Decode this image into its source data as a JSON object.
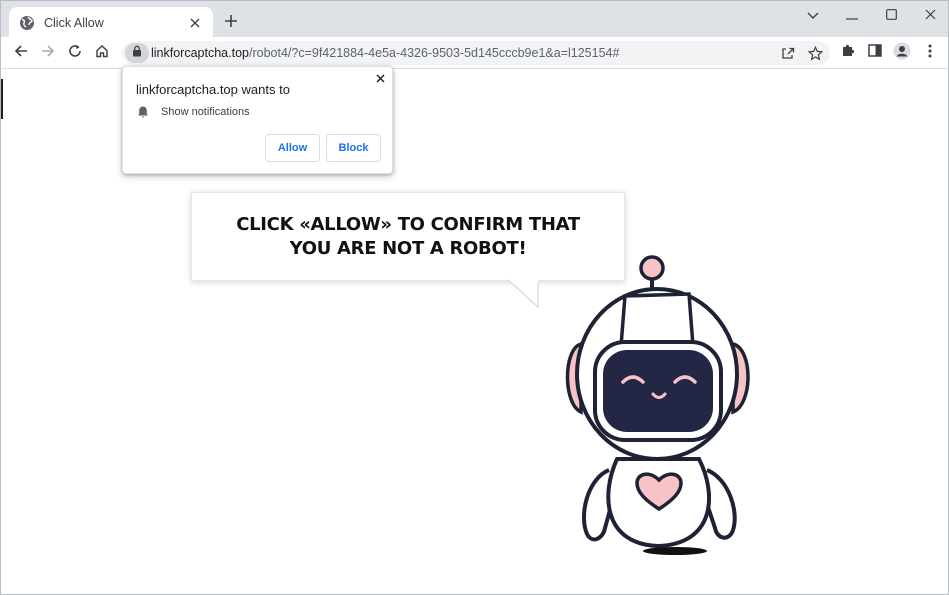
{
  "tab": {
    "title": "Click Allow",
    "favicon": "globe-icon",
    "close": "close-icon"
  },
  "newtab": "plus-icon",
  "window_controls": [
    "chevron-down-icon",
    "minimize-icon",
    "maximize-icon",
    "close-icon"
  ],
  "toolbar": {
    "back": "arrow-left-icon",
    "forward": "arrow-right-icon",
    "reload": "reload-icon",
    "home": "home-icon",
    "url_host": "linkforcaptcha.top",
    "url_path": "/robot4/?c=9f421884-4e5a-4326-9503-5d145cccb9e1&a=l125154#",
    "share": "share-icon",
    "bookmark": "star-icon",
    "extensions": "puzzle-icon",
    "sidepanel": "side-panel-icon",
    "profile": "profile-icon",
    "menu": "kebab-menu-icon"
  },
  "permission_prompt": {
    "title": "linkforcaptcha.top wants to",
    "permission": "Show notifications",
    "allow_label": "Allow",
    "block_label": "Block"
  },
  "page": {
    "headline": "CLICK «ALLOW» TO CONFIRM THAT YOU ARE NOT A ROBOT!"
  },
  "colors": {
    "accent": "#1a73e8",
    "robot_outline": "#1e2235",
    "robot_pink": "#f7c3c6",
    "robot_visor": "#232745"
  }
}
